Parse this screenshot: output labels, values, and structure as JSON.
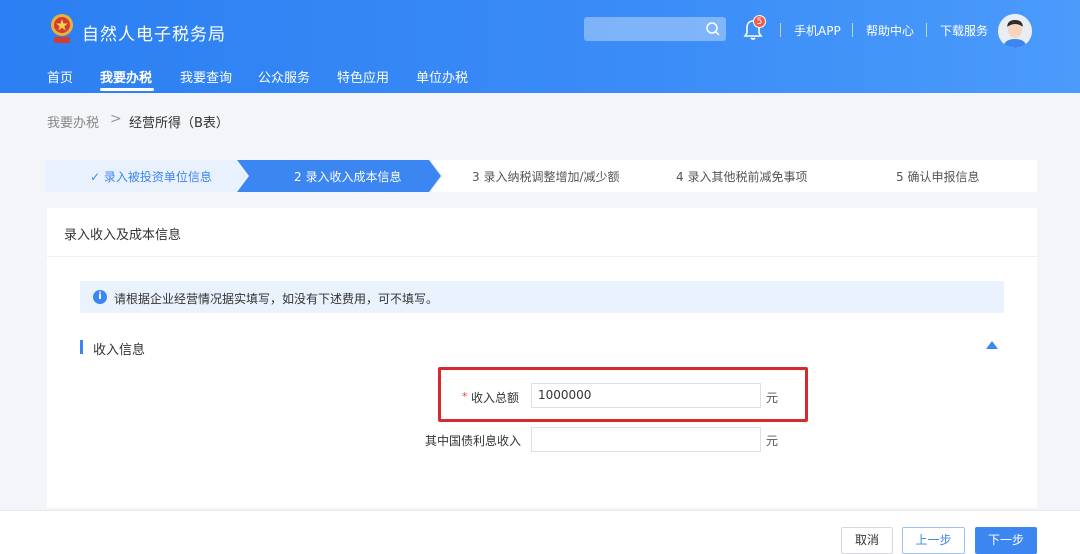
{
  "header": {
    "app_title": "自然人电子税务局",
    "notification_count": "5",
    "links": [
      "手机APP",
      "帮助中心",
      "下载服务"
    ]
  },
  "nav": {
    "items": [
      "首页",
      "我要办税",
      "我要查询",
      "公众服务",
      "特色应用",
      "单位办税"
    ],
    "active_index": 1
  },
  "breadcrumb": {
    "parent": "我要办税",
    "separator": ">",
    "current": "经营所得（B表）"
  },
  "stepper": {
    "steps": [
      {
        "label": "✓ 录入被投资单位信息",
        "state": "done"
      },
      {
        "label": "2 录入收入成本信息",
        "state": "active"
      },
      {
        "label": "3 录入纳税调整增加/减少额",
        "state": "todo"
      },
      {
        "label": "4 录入其他税前减免事项",
        "state": "todo"
      },
      {
        "label": "5 确认申报信息",
        "state": "todo"
      }
    ]
  },
  "card": {
    "title": "录入收入及成本信息",
    "tip": "请根据企业经营情况据实填写，如没有下述费用，可不填写。",
    "section_title": "收入信息",
    "fields": [
      {
        "required": "*",
        "label": "收入总额",
        "value": "1000000",
        "unit": "元"
      },
      {
        "required": "",
        "label": "其中国债利息收入",
        "value": "",
        "unit": "元"
      }
    ]
  },
  "footer": {
    "cancel": "取消",
    "prev": "上一步",
    "next": "下一步"
  },
  "colors": {
    "brand_blue": "#3c86f1",
    "highlight_red": "#d62a2f"
  }
}
